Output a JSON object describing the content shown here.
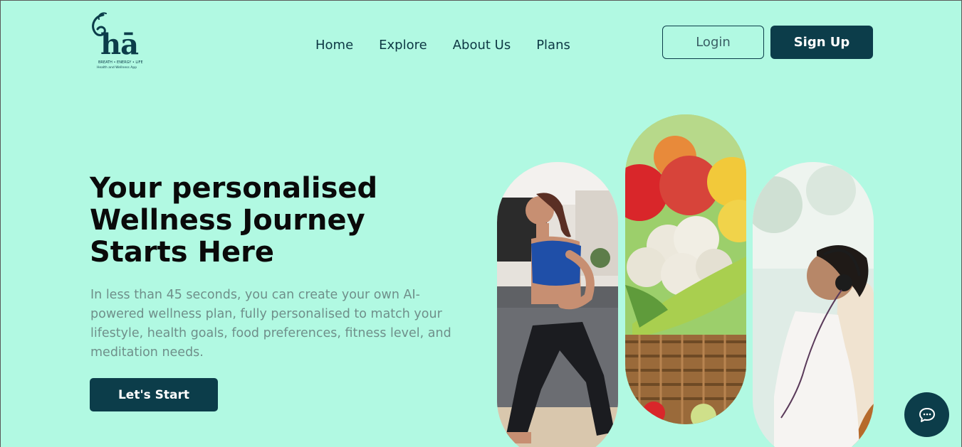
{
  "brand": {
    "name": "hā",
    "tagline": "BREATH • ENERGY • LIFE",
    "subtitle": "Health and Wellness App",
    "color": "#0c3d4a"
  },
  "nav": {
    "items": [
      {
        "label": "Home"
      },
      {
        "label": "Explore"
      },
      {
        "label": "About Us"
      },
      {
        "label": "Plans"
      }
    ]
  },
  "auth": {
    "login_label": "Login",
    "signup_label": "Sign Up"
  },
  "hero": {
    "title": "Your personalised Wellness Journey Starts Here",
    "description": "In less than 45 seconds, you can create your own AI-powered wellness plan, fully personalised to match your lifestyle, health goals, food preferences, fitness level, and meditation needs.",
    "cta_label": "Let's Start"
  },
  "images": [
    {
      "icon": "fitness-photo"
    },
    {
      "icon": "vegetables-photo"
    },
    {
      "icon": "meditation-photo"
    }
  ],
  "chat": {
    "icon": "chat-icon"
  },
  "colors": {
    "background": "#b1f9e2",
    "primary": "#0c3d4a",
    "body_text": "#6f8f8a"
  }
}
